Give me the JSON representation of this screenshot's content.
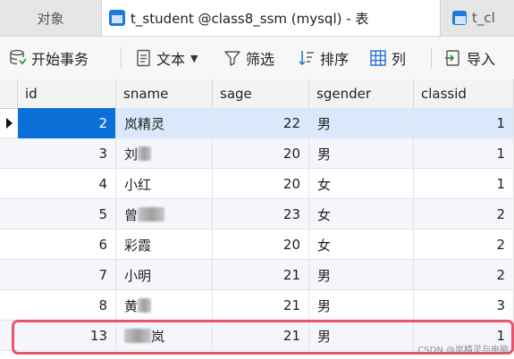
{
  "tabs": {
    "objects": "对象",
    "active": "t_student @class8_ssm (mysql) - 表",
    "other": "t_cl"
  },
  "toolbar": {
    "begin_transaction": "开始事务",
    "text": "文本",
    "filter": "筛选",
    "sort": "排序",
    "columns": "列",
    "import": "导入"
  },
  "grid": {
    "columns": [
      "id",
      "sname",
      "sage",
      "sgender",
      "classid"
    ],
    "rows": [
      {
        "id": "2",
        "sname": "岚精灵",
        "sage": "22",
        "sgender": "男",
        "classid": "1"
      },
      {
        "id": "3",
        "sname": "刘",
        "sage": "20",
        "sgender": "男",
        "classid": "1"
      },
      {
        "id": "4",
        "sname": "小红",
        "sage": "20",
        "sgender": "女",
        "classid": "1"
      },
      {
        "id": "5",
        "sname": "曾",
        "sage": "23",
        "sgender": "女",
        "classid": "2"
      },
      {
        "id": "6",
        "sname": "彩霞",
        "sage": "20",
        "sgender": "女",
        "classid": "2"
      },
      {
        "id": "7",
        "sname": "小明",
        "sage": "21",
        "sgender": "男",
        "classid": "2"
      },
      {
        "id": "8",
        "sname": "黄",
        "sage": "21",
        "sgender": "男",
        "classid": "3"
      },
      {
        "id": "13",
        "sname": "岚",
        "sage": "21",
        "sgender": "男",
        "classid": "1"
      }
    ]
  },
  "watermark": "CSDN @岚精灵与电脑",
  "colors": {
    "selected_cell": "#0a6fd6",
    "selected_row": "#d9e8fb",
    "highlight_box": "#e9546b"
  }
}
